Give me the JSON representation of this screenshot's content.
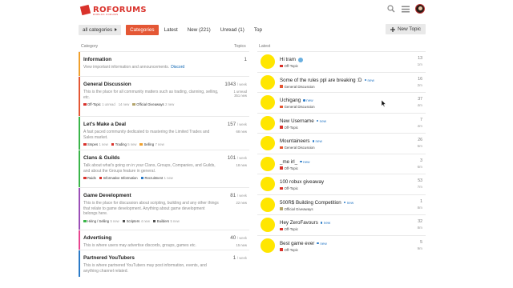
{
  "brand": {
    "name": "ROFORUMS",
    "tagline": "ROBLOX FORUMS"
  },
  "nav": {
    "dropdown": "all categories",
    "tabs": [
      {
        "label": "Categories"
      },
      {
        "label": "Latest"
      },
      {
        "label": "New (221)"
      },
      {
        "label": "Unread (1)"
      },
      {
        "label": "Top"
      }
    ],
    "new_topic": "New Topic"
  },
  "columns": {
    "category": "Category",
    "topics": "Topics",
    "latest": "Latest"
  },
  "categories": [
    {
      "name": "Information",
      "color": "#f0a02d",
      "desc": "View important information and announcements.",
      "link": "Discord",
      "count": "1",
      "per": "",
      "extra": "",
      "subs": []
    },
    {
      "name": "General Discussion",
      "color": "#e45735",
      "desc": "This is the place for all community matters such as trading, clanning, selling, etc.",
      "count": "1043",
      "per": "/ week",
      "extra": "1 unread\n351 new",
      "subs": [
        {
          "label": "Off-Topic",
          "color": "#d9322b",
          "note": "1 unread"
        },
        {
          "label": "",
          "color": "",
          "note": "14 new"
        },
        {
          "label": "Official Giveaways",
          "color": "#b3a46b",
          "note": "2 new"
        }
      ]
    },
    {
      "name": "Let's Make a Deal",
      "color": "#3ab54a",
      "desc": "A fast paced community dedicated to mastering the Limited Trades and Sales market.",
      "count": "157",
      "per": "/ week",
      "extra": "68 new",
      "subs": [
        {
          "label": "Smpes",
          "color": "#d9322b",
          "note": "1 new"
        },
        {
          "label": "Trading",
          "color": "#d9322b",
          "note": "5 new"
        },
        {
          "label": "Selling",
          "color": "#f0a02d",
          "note": "7 new"
        }
      ]
    },
    {
      "name": "Clans & Guilds",
      "color": "#3ab54a",
      "desc": "Talk about what's going on in your Clans, Groups, Companies, and Guilds, and about the Groups feature in general.",
      "count": "101",
      "per": "/ week",
      "extra": "18 new",
      "subs": [
        {
          "label": "Raids",
          "color": "#d9322b",
          "note": ""
        },
        {
          "label": "Informative Information",
          "color": "#d9322b",
          "note": ""
        },
        {
          "label": "Recruitment",
          "color": "#2a7ac7",
          "note": "1 new"
        }
      ]
    },
    {
      "name": "Game Development",
      "color": "#9b4fb7",
      "desc": "This is the place for discussion about scripting, building and any other things that relate to game development. Anything about game development belongs here.",
      "count": "81",
      "per": "/ week",
      "extra": "22 new",
      "subs": [
        {
          "label": "Hiring / Selling",
          "color": "#3ab54a",
          "note": "5 new"
        },
        {
          "label": "Scripters",
          "color": "#555555",
          "note": "4 new"
        },
        {
          "label": "Builders",
          "color": "#555555",
          "note": "5 new"
        }
      ]
    },
    {
      "name": "Advertising",
      "color": "#e8448f",
      "desc": "This is where users may advertise discords, groups, games etc.",
      "count": "40",
      "per": "/ week",
      "extra": "15 new",
      "subs": []
    },
    {
      "name": "Partnered YouTubers",
      "color": "#2a7ac7",
      "desc": "This is where partnered YouTubers may post information, events, and anything channel related.",
      "count": "1",
      "per": "/ week",
      "extra": "",
      "subs": []
    }
  ],
  "latest": [
    {
      "title": "Hi tram",
      "new": false,
      "pinned": true,
      "category": "Off-Topic",
      "cat_color": "#d9322b",
      "replies": "13",
      "age": "1m"
    },
    {
      "title": "Some of the rules ppl are breaking :D",
      "new": true,
      "pinned": false,
      "category": "General Discussion",
      "cat_color": "#e45735",
      "replies": "16",
      "age": "2m"
    },
    {
      "title": "Uchigang",
      "new": true,
      "pinned": false,
      "category": "General Discussion",
      "cat_color": "#e45735",
      "replies": "37",
      "age": "4m"
    },
    {
      "title": "New Username",
      "new": true,
      "pinned": false,
      "category": "Off-Topic",
      "cat_color": "#d9322b",
      "replies": "7",
      "age": "4m"
    },
    {
      "title": "Mountaineers",
      "new": true,
      "pinned": false,
      "category": "General Discussion",
      "cat_color": "#e45735",
      "replies": "26",
      "age": "5m"
    },
    {
      "title": "_me irl_",
      "new": true,
      "pinned": false,
      "category": "Off-Topic",
      "cat_color": "#d9322b",
      "replies": "3",
      "age": "6m"
    },
    {
      "title": "100 robux giveaway",
      "new": false,
      "pinned": false,
      "category": "Off-Topic",
      "cat_color": "#d9322b",
      "replies": "53",
      "age": "7m"
    },
    {
      "title": "500R$ Building Competition",
      "new": true,
      "pinned": false,
      "category": "Official Giveaways",
      "cat_color": "#b3a46b",
      "replies": "1",
      "age": "8m"
    },
    {
      "title": "Hey ZeroFavours",
      "new": true,
      "pinned": false,
      "category": "Off-Topic",
      "cat_color": "#d9322b",
      "replies": "32",
      "age": "8m"
    },
    {
      "title": "Best game ever",
      "new": true,
      "pinned": false,
      "category": "Off-Topic",
      "cat_color": "#d9322b",
      "replies": "5",
      "age": "9m"
    }
  ],
  "labels": {
    "new": "new"
  },
  "icons": {
    "search": "search-icon",
    "menu": "hamburger-menu-icon",
    "avatar": "user-avatar",
    "plus": "plus-icon"
  }
}
